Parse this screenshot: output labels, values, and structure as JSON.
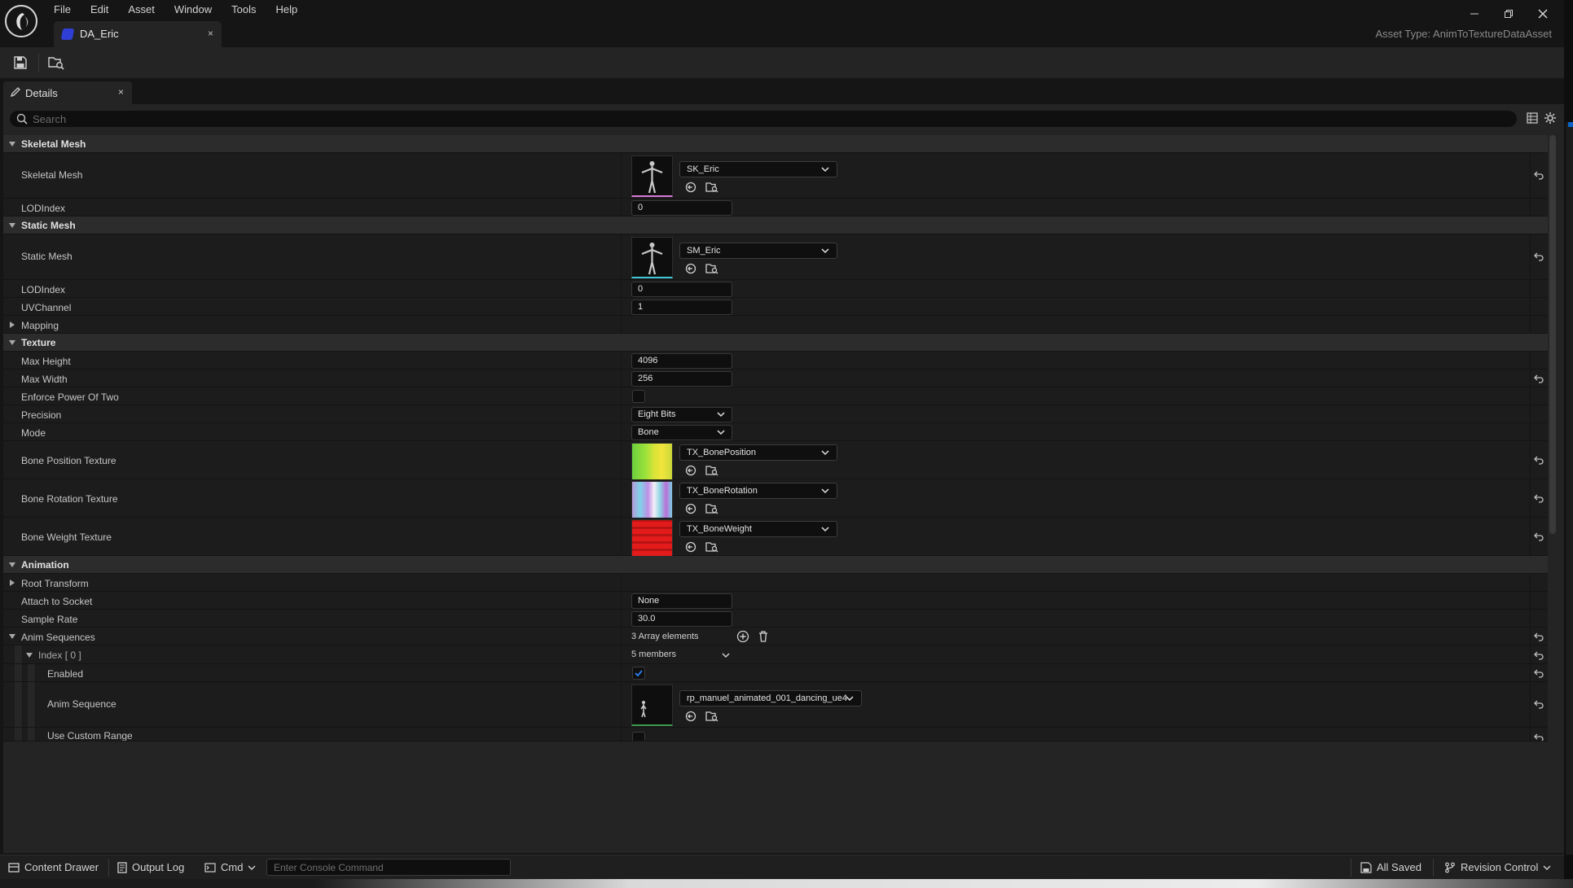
{
  "menu": [
    "File",
    "Edit",
    "Asset",
    "Window",
    "Tools",
    "Help"
  ],
  "window_controls": [
    "minimize",
    "restore",
    "close"
  ],
  "document_tab": {
    "label": "DA_Eric",
    "close": "×"
  },
  "asset_type": "Asset Type: AnimToTextureDataAsset",
  "toolbar": {
    "save_icon": "save-icon",
    "browse_icon": "browse-to-asset-icon"
  },
  "details_tab": {
    "label": "Details",
    "close": "×"
  },
  "search": {
    "placeholder": "Search",
    "value": ""
  },
  "sections": {
    "skeletal_mesh": {
      "title": "Skeletal Mesh",
      "mesh_label": "Skeletal Mesh",
      "mesh_value": "SK_Eric",
      "lod_label": "LODIndex",
      "lod_value": "0"
    },
    "static_mesh": {
      "title": "Static Mesh",
      "mesh_label": "Static Mesh",
      "mesh_value": "SM_Eric",
      "lod_label": "LODIndex",
      "lod_value": "0",
      "uv_label": "UVChannel",
      "uv_value": "1",
      "mapping_label": "Mapping"
    },
    "texture": {
      "title": "Texture",
      "max_height_label": "Max Height",
      "max_height_value": "4096",
      "max_width_label": "Max Width",
      "max_width_value": "256",
      "enforce_label": "Enforce Power Of Two",
      "enforce_checked": false,
      "precision_label": "Precision",
      "precision_value": "Eight Bits",
      "mode_label": "Mode",
      "mode_value": "Bone",
      "bone_position_label": "Bone Position Texture",
      "bone_position_value": "TX_BonePosition",
      "bone_rotation_label": "Bone Rotation Texture",
      "bone_rotation_value": "TX_BoneRotation",
      "bone_weight_label": "Bone Weight Texture",
      "bone_weight_value": "TX_BoneWeight"
    },
    "animation": {
      "title": "Animation",
      "root_transform_label": "Root Transform",
      "attach_label": "Attach to Socket",
      "attach_value": "None",
      "sample_rate_label": "Sample Rate",
      "sample_rate_value": "30.0",
      "anim_sequences_label": "Anim Sequences",
      "anim_sequences_value": "3 Array elements",
      "index_label": "Index [ 0 ]",
      "index_value": "5 members",
      "enabled_label": "Enabled",
      "enabled_checked": true,
      "anim_sequence_label": "Anim Sequence",
      "anim_sequence_value": "rp_manuel_animated_001_dancing_ue4",
      "custom_range_label": "Use Custom Range"
    }
  },
  "statusbar": {
    "content_drawer": "Content Drawer",
    "output_log": "Output Log",
    "cmd": "Cmd",
    "console_placeholder": "Enter Console Command",
    "all_saved": "All Saved",
    "revision_control": "Revision Control"
  },
  "colors": {
    "accent_blue": "#2f3fd6",
    "check_blue": "#2d7ff0",
    "skeletal_underline": "#d77ad8",
    "static_underline": "#3fc8d6",
    "anim_underline": "#3c9a4c"
  }
}
